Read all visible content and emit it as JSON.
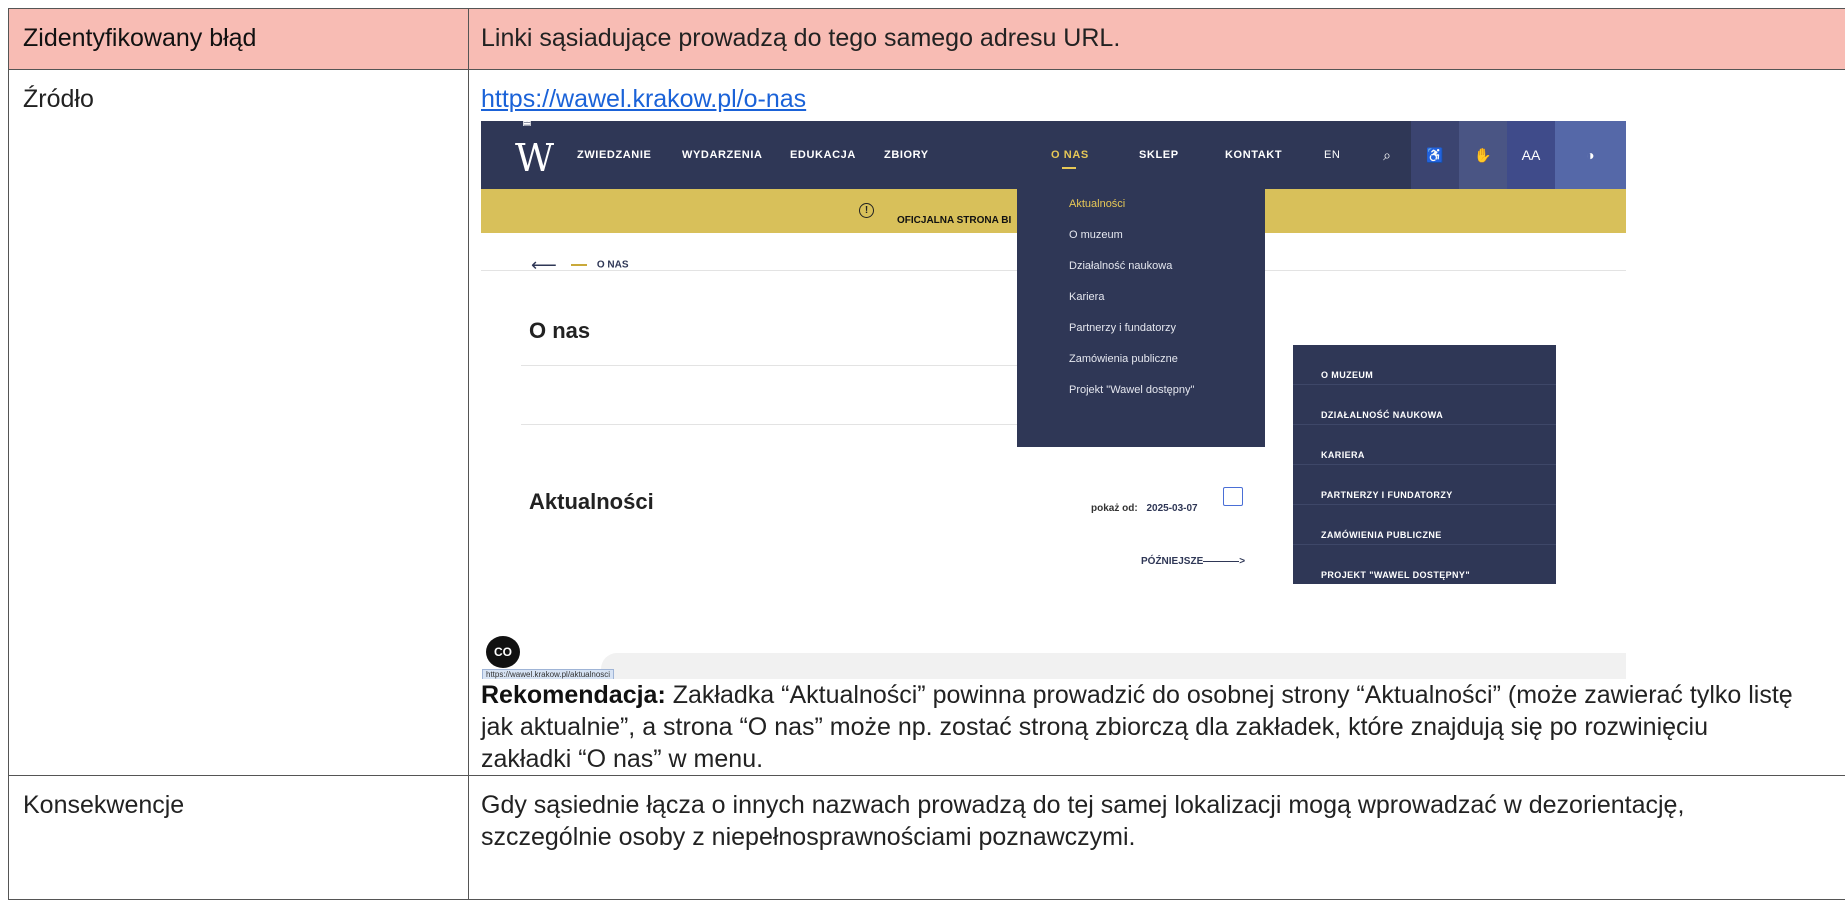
{
  "header": {
    "label": "Zidentyfikowany błąd",
    "value": "Linki sąsiadujące prowadzą do tego samego adresu URL."
  },
  "source": {
    "label": "Źródło",
    "url": "https://wawel.krakow.pl/o-nas"
  },
  "screenshot": {
    "nav_items": [
      "ZWIEDZANIE",
      "WYDARZENIA",
      "EDUKACJA",
      "ZBIORY",
      "O NAS",
      "SKLEP",
      "KONTAKT"
    ],
    "lang": "EN",
    "tools": [
      "search-icon",
      "accessibility-icon",
      "sign-language-icon",
      "font-size-icon",
      "contrast-icon"
    ],
    "font_size_label": "AA",
    "banner_text": "OFICJALNA STRONA BI",
    "breadcrumb": "O NAS",
    "heading_onas": "O nas",
    "heading_aktualnosci": "Aktualności",
    "pokaz_label": "pokaż od:",
    "pokaz_date": "2025-03-07",
    "pozniej_label": "PÓŹNIEJSZE",
    "dropdown_items": [
      "Aktualności",
      "O muzeum",
      "Działalność naukowa",
      "Kariera",
      "Partnerzy i fundatorzy",
      "Zamówienia publiczne",
      "Projekt \"Wawel dostępny\""
    ],
    "submenu_items": [
      "O MUZEUM",
      "DZIAŁALNOŚĆ NAUKOWA",
      "KARIERA",
      "PARTNERZY I FUNDATORZY",
      "ZAMÓWIENIA PUBLICZNE",
      "PROJEKT \"WAWEL DOSTĘPNY\""
    ],
    "cc_label": "CO",
    "status_url": "https://wawel.krakow.pl/aktualnosci",
    "colors": {
      "nav": "#2f3756",
      "accent": "#e7c856",
      "banner": "#d8c05a"
    }
  },
  "recommendation": {
    "bold": "Rekomendacja:",
    "line1": " Zakładka “Aktualności” powinna prowadzić do osobnej strony “Aktualności” (może zawierać tylko listę",
    "line2": "jak aktualnie”, a strona “O nas” może np. zostać stroną zbiorczą dla zakładek, które znajdują się po rozwinięciu",
    "line3": "zakładki “O nas” w menu."
  },
  "consequences": {
    "label": "Konsekwencje",
    "line1": "Gdy sąsiednie łącza o innych nazwach prowadzą do tej samej lokalizacji mogą wprowadzać w dezorientację,",
    "line2": "szczególnie osoby z niepełnosprawnościami poznawczymi."
  }
}
